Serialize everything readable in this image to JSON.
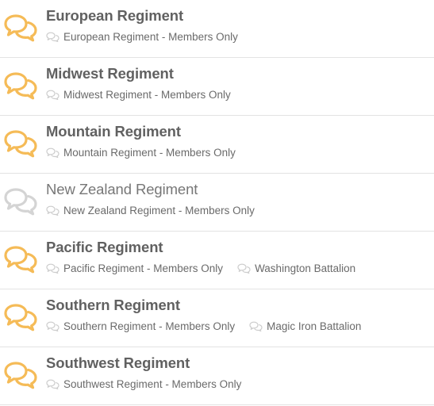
{
  "colors": {
    "unread_icon": "#f5bb57",
    "read_icon": "#d4d4d4",
    "subforum_icon": "#cccccc"
  },
  "forums": [
    {
      "title": "European Regiment",
      "unread": true,
      "subforums": [
        "European Regiment - Members Only"
      ]
    },
    {
      "title": "Midwest Regiment",
      "unread": true,
      "subforums": [
        "Midwest Regiment - Members Only"
      ]
    },
    {
      "title": "Mountain Regiment",
      "unread": true,
      "subforums": [
        "Mountain Regiment - Members Only"
      ]
    },
    {
      "title": "New Zealand Regiment",
      "unread": false,
      "subforums": [
        "New Zealand Regiment - Members Only"
      ]
    },
    {
      "title": "Pacific Regiment",
      "unread": true,
      "subforums": [
        "Pacific Regiment - Members Only",
        "Washington Battalion"
      ]
    },
    {
      "title": "Southern Regiment",
      "unread": true,
      "subforums": [
        "Southern Regiment - Members Only",
        "Magic Iron Battalion"
      ]
    },
    {
      "title": "Southwest Regiment",
      "unread": true,
      "subforums": [
        "Southwest Regiment - Members Only"
      ]
    }
  ]
}
